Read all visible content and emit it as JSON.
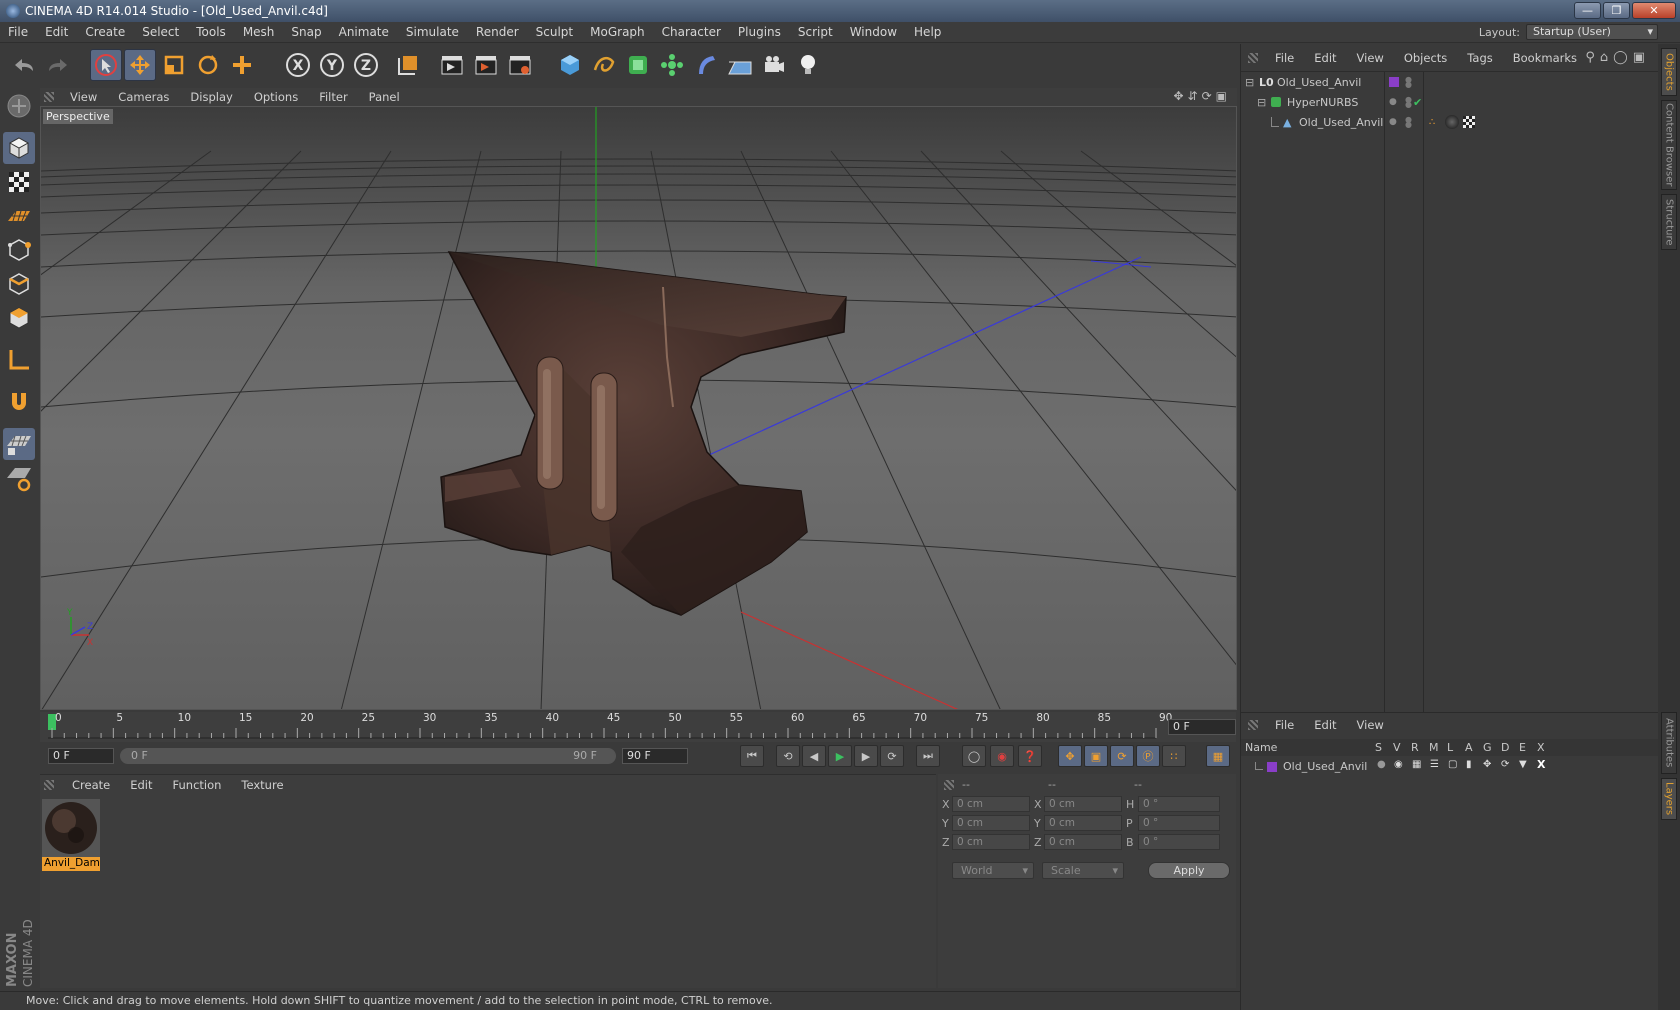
{
  "window": {
    "title": "CINEMA 4D R14.014 Studio - [Old_Used_Anvil.c4d]"
  },
  "menubar": {
    "items": [
      "File",
      "Edit",
      "Create",
      "Select",
      "Tools",
      "Mesh",
      "Snap",
      "Animate",
      "Simulate",
      "Render",
      "Sculpt",
      "MoGraph",
      "Character",
      "Plugins",
      "Script",
      "Window",
      "Help"
    ]
  },
  "layout": {
    "label": "Layout:",
    "value": "Startup (User)"
  },
  "viewport": {
    "menu": [
      "View",
      "Cameras",
      "Display",
      "Options",
      "Filter",
      "Panel"
    ],
    "label": "Perspective"
  },
  "timeline": {
    "ticks": [
      "0",
      "5",
      "10",
      "15",
      "20",
      "25",
      "30",
      "35",
      "40",
      "45",
      "50",
      "55",
      "60",
      "65",
      "70",
      "75",
      "80",
      "85",
      "90"
    ],
    "end_field": "0 F"
  },
  "transport": {
    "current": "0 F",
    "range_start": "0 F",
    "range_end": "90 F",
    "max": "90 F"
  },
  "materials": {
    "menu": [
      "Create",
      "Edit",
      "Function",
      "Texture"
    ],
    "items": [
      {
        "name": "Anvil_Dama"
      }
    ]
  },
  "coordinates": {
    "headers": [
      "--",
      "--",
      "--"
    ],
    "rows": [
      {
        "a": "X",
        "av": "0 cm",
        "b": "X",
        "bv": "0 cm",
        "c": "H",
        "cv": "0 °"
      },
      {
        "a": "Y",
        "av": "0 cm",
        "b": "Y",
        "bv": "0 cm",
        "c": "P",
        "cv": "0 °"
      },
      {
        "a": "Z",
        "av": "0 cm",
        "b": "Z",
        "bv": "0 cm",
        "c": "B",
        "cv": "0 °"
      }
    ],
    "world": "World",
    "scale": "Scale",
    "apply": "Apply"
  },
  "objects": {
    "menu": [
      "File",
      "Edit",
      "View",
      "Objects",
      "Tags",
      "Bookmarks"
    ],
    "tree": [
      {
        "name": "Old_Used_Anvil"
      },
      {
        "name": "HyperNURBS"
      },
      {
        "name": "Old_Used_Anvil"
      }
    ]
  },
  "layers": {
    "menu": [
      "File",
      "Edit",
      "View"
    ],
    "header": {
      "name": "Name",
      "cols": [
        "S",
        "V",
        "R",
        "M",
        "L",
        "A",
        "G",
        "D",
        "E",
        "X"
      ]
    },
    "rows": [
      {
        "name": "Old_Used_Anvil"
      }
    ]
  },
  "sidetabs": [
    "Objects",
    "Content Browser",
    "Structure",
    "Attributes",
    "Layers"
  ],
  "status": {
    "text": "Move: Click and drag to move elements. Hold down SHIFT to quantize movement / add to the selection in point mode, CTRL to remove."
  },
  "brand": {
    "line1": "MAXON",
    "line2": "CINEMA 4D"
  },
  "colors": {
    "accent": "#f0a030",
    "selection": "#5b6a85",
    "layer": "#8a3ec8",
    "x_axis": "#c83232",
    "y_axis": "#22a022",
    "z_axis": "#3a3ad8"
  }
}
